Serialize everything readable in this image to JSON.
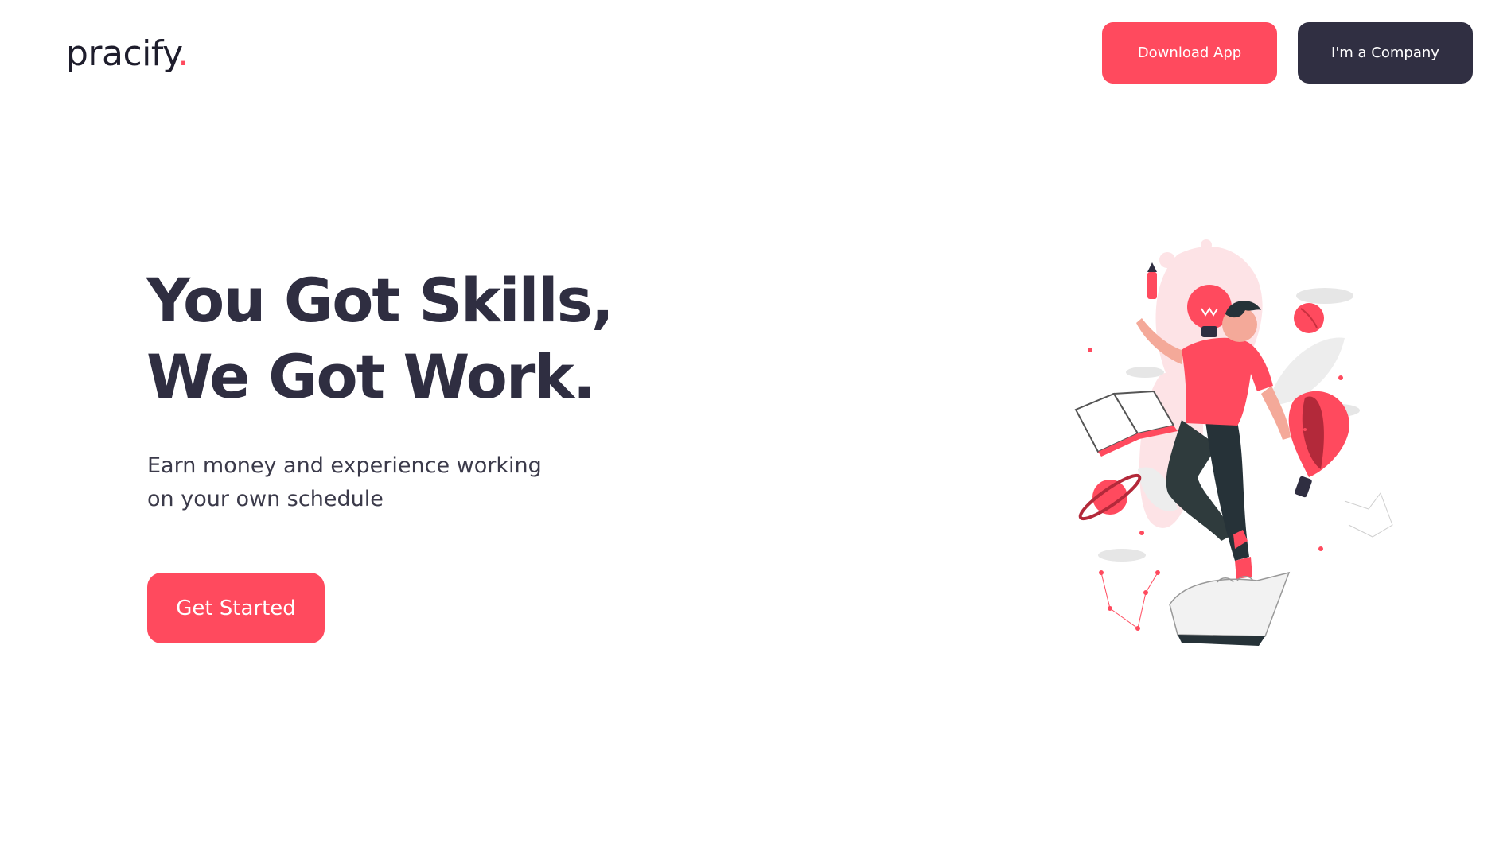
{
  "header": {
    "logo_text": "pracify",
    "logo_dot": ".",
    "download_label": "Download App",
    "company_label": "I'm a Company"
  },
  "hero": {
    "headline_line1": "You Got Skills,",
    "headline_line2": "We Got Work.",
    "subtitle_line1": "Earn money and experience working",
    "subtitle_line2": "on your own schedule",
    "cta_label": "Get Started"
  },
  "illustration": {
    "icon": "person-skills-illustration"
  },
  "colors": {
    "accent": "#ff4a5e",
    "dark": "#302f42",
    "text": "#2f2e41",
    "background": "#ffffff"
  }
}
